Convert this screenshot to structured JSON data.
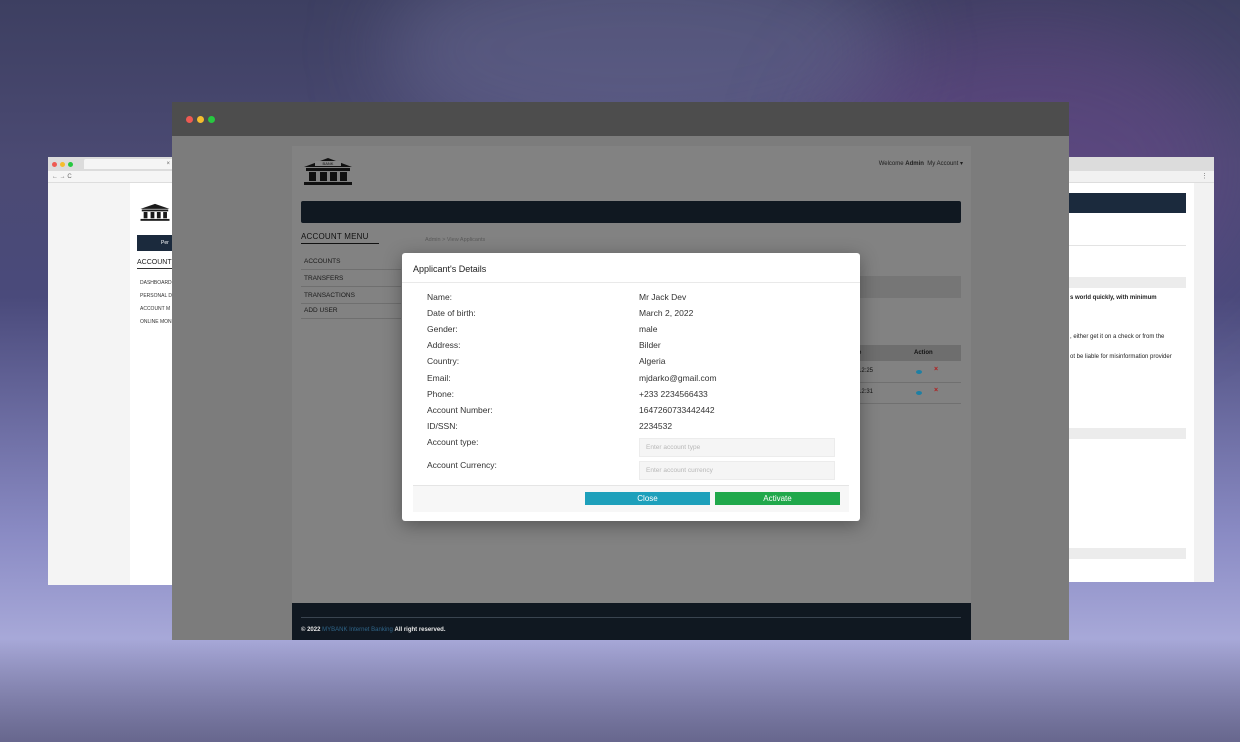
{
  "left_window": {
    "tab_close": "×",
    "address": "← → C",
    "button_label": "Per",
    "menu_heading": "ACCOUNT M",
    "menu_items": [
      "DASHBOARD",
      "PERSONAL D",
      "ACCOUNT M",
      "ONLINE MON"
    ]
  },
  "right_window": {
    "addr_menu": "⋮",
    "texts": [
      "s world quickly, with minimum",
      ", either get it on a check or from the",
      "ot be liable for misinformation provider"
    ]
  },
  "header": {
    "welcome_prefix": "Welcome",
    "welcome_user": "Admin",
    "my_account": "My Account ▾",
    "logo_text": "BANK"
  },
  "sidebar": {
    "heading": "ACCOUNT MENU",
    "items": [
      "ACCOUNTS",
      "TRANSFERS",
      "TRANSACTIONS",
      "ADD USER"
    ]
  },
  "breadcrumb": "Admin  >  View Applicants",
  "table": {
    "headers": [
      "e",
      "Action"
    ],
    "rows": [
      {
        "time": "12:25"
      },
      {
        "time": "12:31"
      }
    ]
  },
  "footer": {
    "year": "© 2022",
    "brand": "MYBANK",
    "brand_rest": "Internet Banking",
    "rights": "All right reserved."
  },
  "modal": {
    "title": "Applicant's Details",
    "fields": [
      {
        "label": "Name:",
        "value": "Mr Jack Dev"
      },
      {
        "label": "Date of birth:",
        "value": "March 2, 2022"
      },
      {
        "label": "Gender:",
        "value": "male"
      },
      {
        "label": "Address:",
        "value": "Bilder"
      },
      {
        "label": "Country:",
        "value": "Algeria"
      },
      {
        "label": "Email:",
        "value": "mjdarko@gmail.com"
      },
      {
        "label": "Phone:",
        "value": "+233 2234566433"
      },
      {
        "label": "Account Number:",
        "value": "1647260733442442"
      },
      {
        "label": "ID/SSN:",
        "value": "2234532"
      }
    ],
    "account_type": {
      "label": "Account type:",
      "placeholder": "Enter account type"
    },
    "account_currency": {
      "label": "Account Currency:",
      "placeholder": "Enter account currency"
    },
    "close_label": "Close",
    "activate_label": "Activate"
  },
  "colors": {
    "navbar": "#101821",
    "close_button": "#1ea0bb",
    "activate_button": "#20a84b"
  }
}
